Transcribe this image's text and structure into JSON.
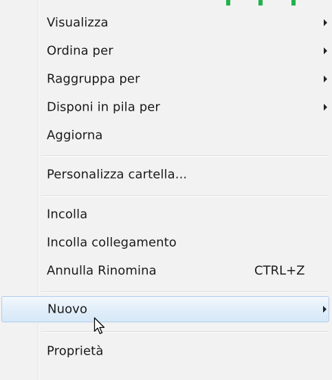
{
  "menu": {
    "items": [
      {
        "label": "Visualizza",
        "submenu": true
      },
      {
        "label": "Ordina per",
        "submenu": true
      },
      {
        "label": "Raggruppa per",
        "submenu": true
      },
      {
        "label": "Disponi in pila per",
        "submenu": true
      },
      {
        "label": "Aggiorna",
        "submenu": false
      },
      {
        "label": "Personalizza cartella...",
        "submenu": false
      },
      {
        "label": "Incolla",
        "submenu": false
      },
      {
        "label": "Incolla collegamento",
        "submenu": false
      },
      {
        "label": "Annulla Rinomina",
        "shortcut": "CTRL+Z",
        "submenu": false
      },
      {
        "label": "Nuovo",
        "submenu": true,
        "highlighted": true
      },
      {
        "label": "Proprietà",
        "submenu": false
      }
    ]
  },
  "colors": {
    "menu_background": "#f2f2f2",
    "highlight_border": "#aeccec",
    "highlight_fill": "#dbeaf8",
    "top_accent": "#22b24c"
  },
  "icons": {
    "submenu_arrow": "triangle-right",
    "cursor": "arrow-pointer"
  }
}
